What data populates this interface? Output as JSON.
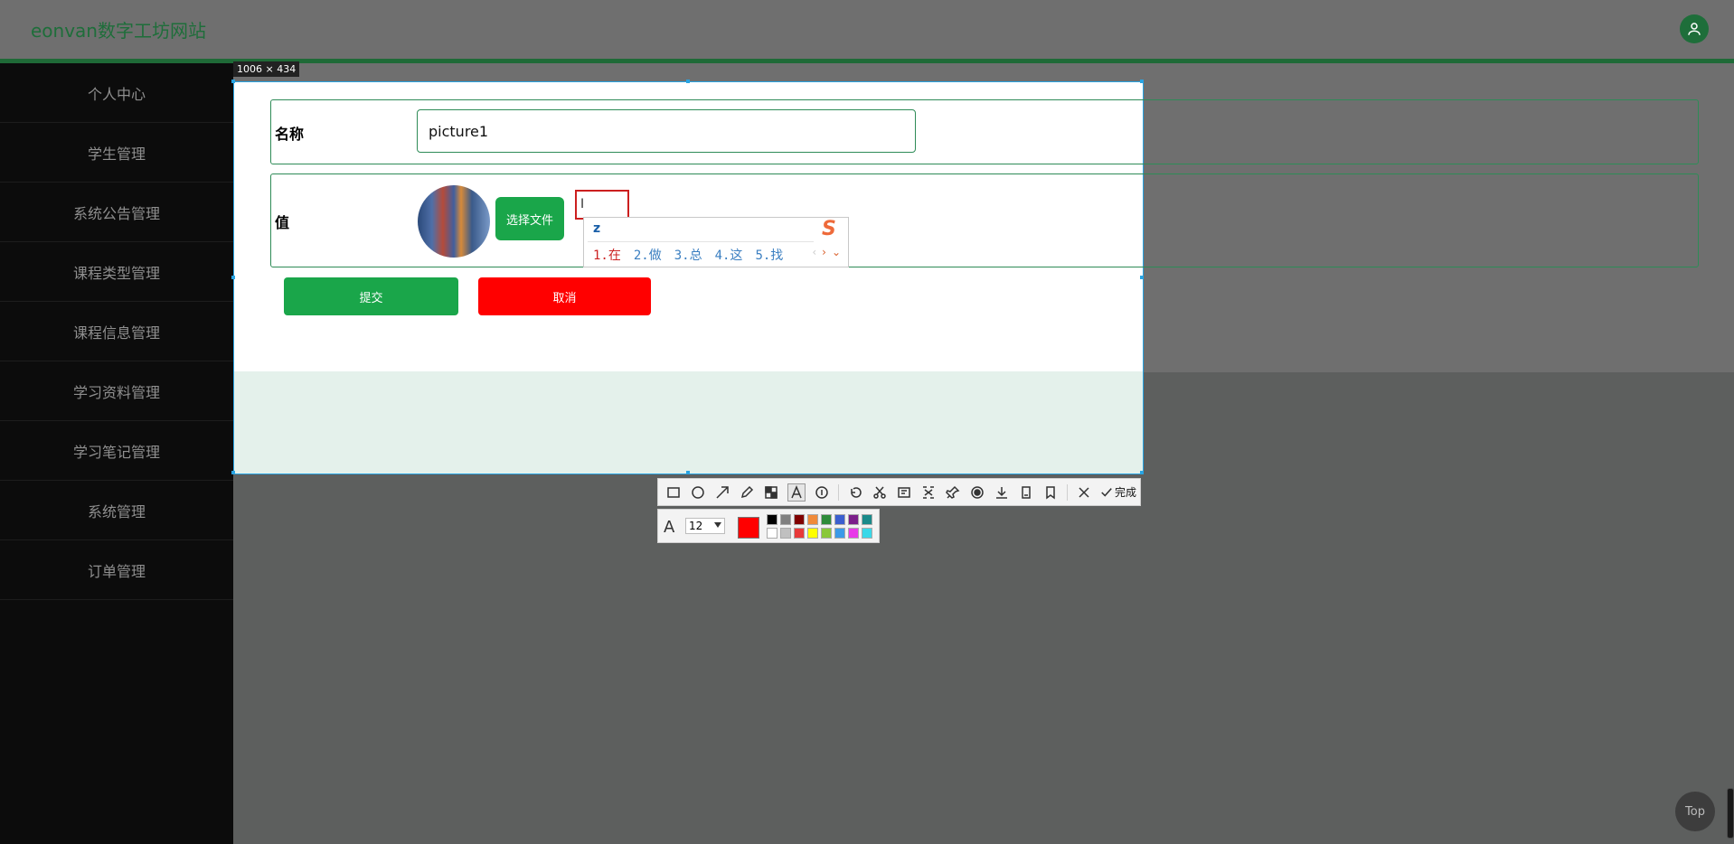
{
  "header": {
    "site_title": "eonvan数字工坊网站"
  },
  "sidebar": {
    "items": [
      {
        "label": "个人中心"
      },
      {
        "label": "学生管理"
      },
      {
        "label": "系统公告管理"
      },
      {
        "label": "课程类型管理"
      },
      {
        "label": "课程信息管理"
      },
      {
        "label": "学习资料管理"
      },
      {
        "label": "学习笔记管理"
      },
      {
        "label": "系统管理"
      },
      {
        "label": "订单管理"
      }
    ]
  },
  "selection": {
    "size_label": "1006 × 434"
  },
  "form": {
    "name_label": "名称",
    "name_value": "picture1",
    "value_label": "值",
    "choose_file_label": "选择文件",
    "submit_label": "提交",
    "cancel_label": "取消"
  },
  "ime": {
    "input": "z",
    "candidates": [
      "1.在",
      "2.做",
      "3.总",
      "4.这",
      "5.找"
    ],
    "logo": "S"
  },
  "toolbar": {
    "icons": [
      "rectangle-icon",
      "ellipse-icon",
      "arrow-icon",
      "pen-icon",
      "mosaic-icon",
      "text-icon",
      "serial-number-icon",
      "undo-icon",
      "ai-cutout-icon",
      "ocr-icon",
      "translate-icon",
      "pin-icon",
      "record-icon",
      "save-icon",
      "long-screenshot-icon",
      "bookmark-icon",
      "close-icon"
    ],
    "done_label": "完成"
  },
  "text_options": {
    "font_size": "12",
    "current_color": "#ff0000",
    "palette": [
      "#000000",
      "#808080",
      "#800000",
      "#f08a3a",
      "#2e8b3a",
      "#3b5fcf",
      "#7b1f8a",
      "#1a8a8a",
      "#ffffff",
      "#c0c0c0",
      "#e83a3a",
      "#ffff00",
      "#8ac83a",
      "#3b9ae8",
      "#e83ae8",
      "#3ad8e8"
    ]
  },
  "misc": {
    "top_label": "Top"
  }
}
